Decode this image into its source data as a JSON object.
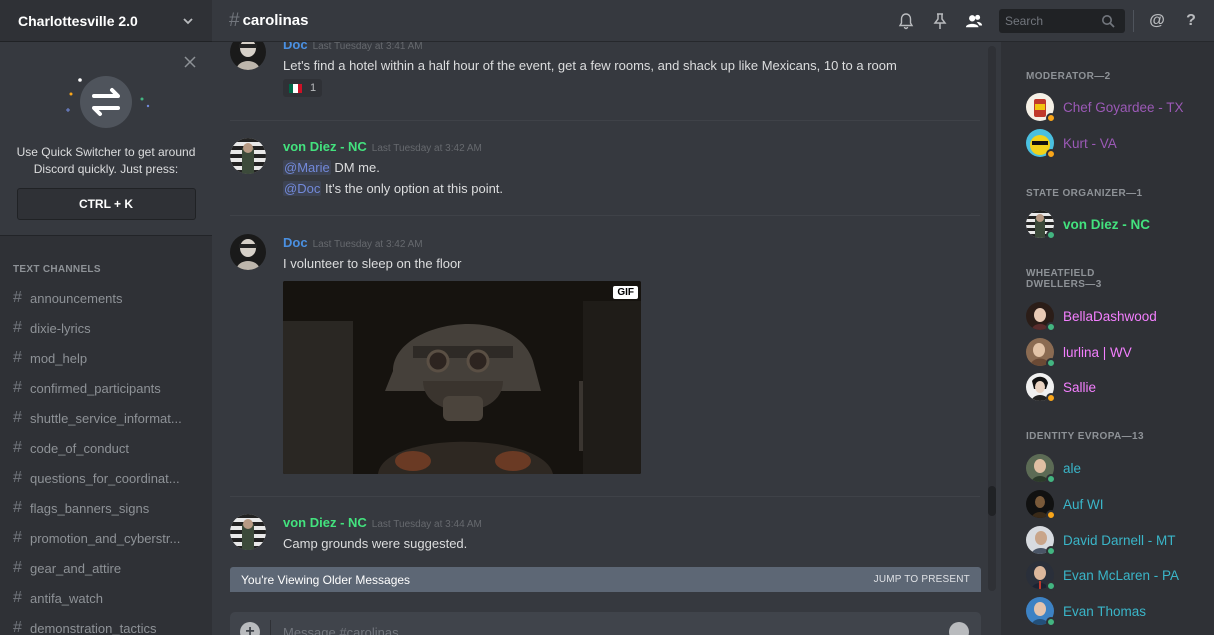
{
  "guild": {
    "name": "Charlottesville 2.0"
  },
  "quick_switcher": {
    "text": "Use Quick Switcher to get around Discord quickly. Just press:",
    "shortcut": "CTRL + K"
  },
  "channels": {
    "header": "TEXT CHANNELS",
    "items": [
      "announcements",
      "dixie-lyrics",
      "mod_help",
      "confirmed_participants",
      "shuttle_service_informat...",
      "code_of_conduct",
      "questions_for_coordinat...",
      "flags_banners_signs",
      "promotion_and_cyberstr...",
      "gear_and_attire",
      "antifa_watch",
      "demonstration_tactics"
    ]
  },
  "topbar": {
    "channel_hash": "#",
    "channel_name": "carolinas",
    "search_placeholder": "Search",
    "mention_icon": "@",
    "help_icon": "?"
  },
  "messages": [
    {
      "author": "Doc",
      "author_color": "#4a90e2",
      "timestamp": "Last Tuesday at 3:41 AM",
      "lines": [
        "Let's find a hotel within a half hour of the event, get a few rooms, and shack up like Mexicans, 10 to a room"
      ],
      "reaction": {
        "emoji": "mexican-flag",
        "count": "1"
      }
    },
    {
      "author": "von Diez - NC",
      "author_color": "#43e27e",
      "timestamp": "Last Tuesday at 3:42 AM",
      "lines": [
        {
          "mention": "@Marie",
          "text": " DM me."
        },
        {
          "mention": "@Doc",
          "text": " It's the only option at this point."
        }
      ]
    },
    {
      "author": "Doc",
      "author_color": "#4a90e2",
      "timestamp": "Last Tuesday at 3:42 AM",
      "lines": [
        "I volunteer to sleep on the floor"
      ],
      "gif_badge": "GIF"
    },
    {
      "author": "von Diez - NC",
      "author_color": "#43e27e",
      "timestamp": "Last Tuesday at 3:44 AM",
      "lines": [
        "Camp grounds were suggested."
      ]
    }
  ],
  "older_bar": {
    "text": "You're Viewing Older Messages",
    "jump": "JUMP TO PRESENT"
  },
  "composer": {
    "placeholder": "Message #carolinas"
  },
  "members": {
    "groups": [
      {
        "title": "MODERATOR—2",
        "members": [
          {
            "name": "Chef Goyardee - TX",
            "color": "#9b59b6",
            "status": "idle"
          },
          {
            "name": "Kurt - VA",
            "color": "#9b59b6",
            "status": "idle"
          }
        ]
      },
      {
        "title": "STATE ORGANIZER—1",
        "members": [
          {
            "name": "von Diez - NC",
            "color": "#43e27e",
            "status": "online"
          }
        ]
      },
      {
        "title_line1": "WHEATFIELD",
        "title_line2": "DWELLERS—3",
        "members": [
          {
            "name": "BellaDashwood",
            "color": "#f47fff",
            "status": "online"
          },
          {
            "name": "lurlina | WV",
            "color": "#f47fff",
            "status": "online"
          },
          {
            "name": "Sallie",
            "color": "#f47fff",
            "status": "idle"
          }
        ]
      },
      {
        "title": "IDENTITY EVROPA—13",
        "members": [
          {
            "name": "ale",
            "color": "#3ab5c8",
            "status": "online"
          },
          {
            "name": "Auf WI",
            "color": "#3ab5c8",
            "status": "idle"
          },
          {
            "name": "David Darnell - MT",
            "color": "#3ab5c8",
            "status": "online"
          },
          {
            "name": "Evan McLaren - PA",
            "color": "#3ab5c8",
            "status": "online"
          },
          {
            "name": "Evan Thomas",
            "color": "#3ab5c8",
            "status": "online"
          }
        ]
      }
    ]
  },
  "colors": {
    "status_online": "#43b581",
    "status_idle": "#faa61a",
    "mention": "#7289da"
  }
}
